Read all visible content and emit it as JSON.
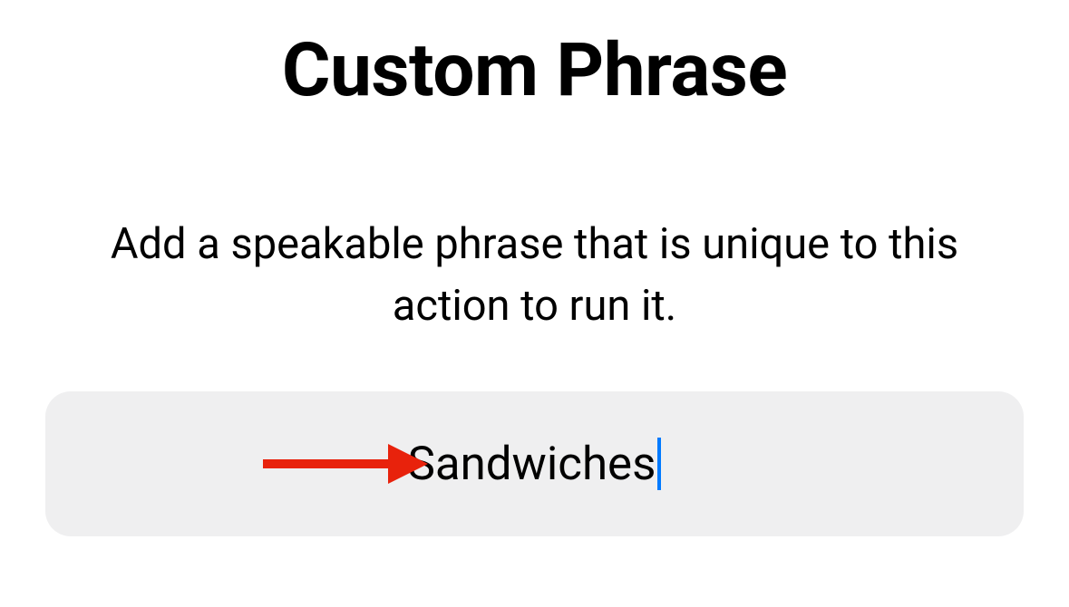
{
  "title": "Custom Phrase",
  "description": "Add a speakable phrase that is unique to this action to run it.",
  "input": {
    "value": "Sandwiches"
  },
  "annotation": {
    "arrow_color": "#e8220c",
    "cursor_color": "#007aff"
  }
}
